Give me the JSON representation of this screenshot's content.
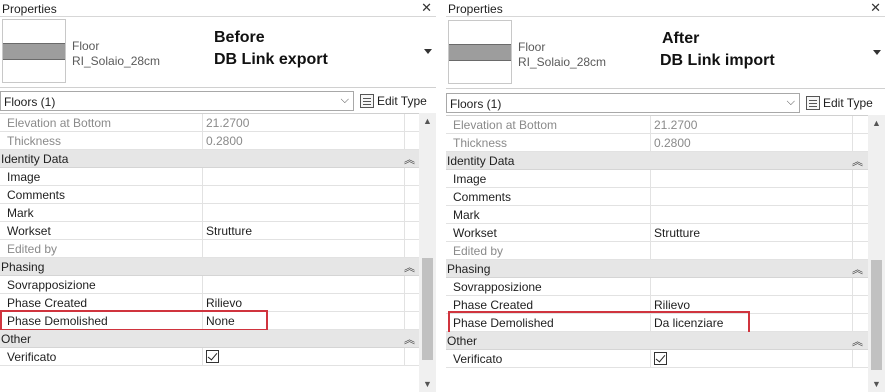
{
  "panels": {
    "left": {
      "title": "Properties",
      "type_family": "Floor",
      "type_name": "RI_Solaio_28cm",
      "annotation_line1": "Before",
      "annotation_line2": "DB Link export",
      "selector": "Floors (1)",
      "edit_type": "Edit Type",
      "rows": {
        "elevation_label": "Elevation at Bottom",
        "elevation_value": "21.2700",
        "thickness_label": "Thickness",
        "thickness_value": "0.2800",
        "identity_group": "Identity Data",
        "image_label": "Image",
        "comments_label": "Comments",
        "mark_label": "Mark",
        "workset_label": "Workset",
        "workset_value": "Strutture",
        "edited_by_label": "Edited by",
        "phasing_group": "Phasing",
        "sovrapposizione_label": "Sovrapposizione",
        "phase_created_label": "Phase Created",
        "phase_created_value": "Rilievo",
        "phase_demolished_label": "Phase Demolished",
        "phase_demolished_value": "None",
        "other_group": "Other",
        "verificato_label": "Verificato",
        "verificato_checked": true
      }
    },
    "right": {
      "title": "Properties",
      "type_family": "Floor",
      "type_name": "RI_Solaio_28cm",
      "annotation_line1": "After",
      "annotation_line2": "DB Link import",
      "selector": "Floors (1)",
      "edit_type": "Edit Type",
      "rows": {
        "elevation_label": "Elevation at Bottom",
        "elevation_value": "21.2700",
        "thickness_label": "Thickness",
        "thickness_value": "0.2800",
        "identity_group": "Identity Data",
        "image_label": "Image",
        "comments_label": "Comments",
        "mark_label": "Mark",
        "workset_label": "Workset",
        "workset_value": "Strutture",
        "edited_by_label": "Edited by",
        "phasing_group": "Phasing",
        "sovrapposizione_label": "Sovrapposizione",
        "phase_created_label": "Phase Created",
        "phase_created_value": "Rilievo",
        "phase_demolished_label": "Phase Demolished",
        "phase_demolished_value": "Da licenziare",
        "other_group": "Other",
        "verificato_label": "Verificato",
        "verificato_checked": true
      }
    }
  },
  "icons": {
    "close": "close-icon",
    "collapse": "chevron-up-icon",
    "dropdown": "chevron-down-icon",
    "edit_type": "edit-type-icon",
    "checkbox": "checkbox-checked-icon"
  },
  "colors": {
    "highlight_border": "#d0343e",
    "group_header_bg": "#e6e6e6",
    "readonly_text": "#8a8a8a"
  }
}
